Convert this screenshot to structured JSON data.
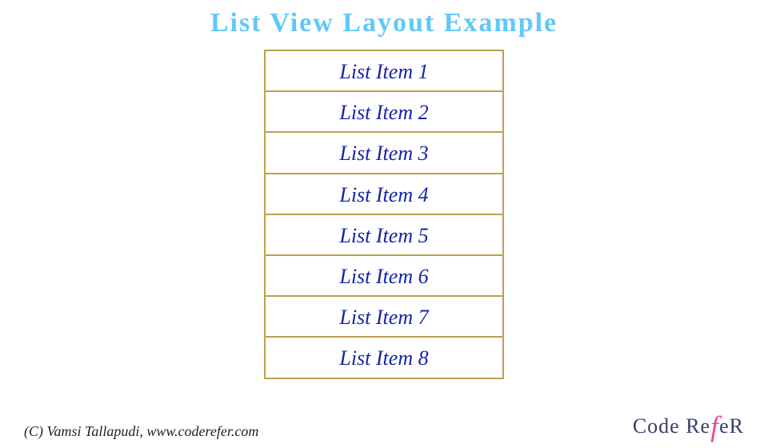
{
  "title": "List View Layout Example",
  "list": {
    "items": [
      {
        "label": "List Item 1"
      },
      {
        "label": "List Item 2"
      },
      {
        "label": "List Item 3"
      },
      {
        "label": "List Item 4"
      },
      {
        "label": "List Item 5"
      },
      {
        "label": "List Item 6"
      },
      {
        "label": "List Item 7"
      },
      {
        "label": "List Item 8"
      }
    ]
  },
  "footer": {
    "copyright": "(C) Vamsi Tallapudi, www.coderefer.com",
    "logo_pre": "Code Re",
    "logo_f": "f",
    "logo_post": "eR"
  }
}
